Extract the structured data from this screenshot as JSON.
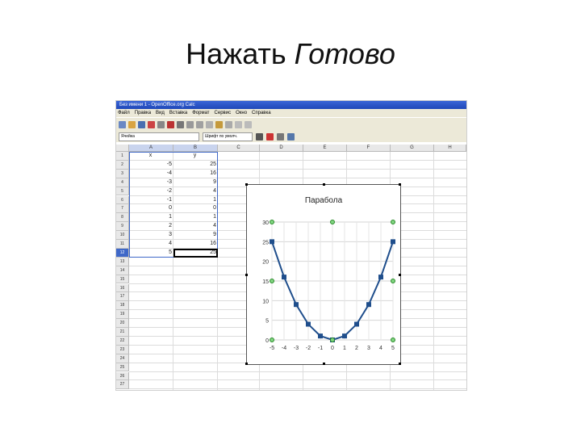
{
  "slide": {
    "title_normal": "Нажать ",
    "title_italic": "Готово"
  },
  "window": {
    "title": "Без имени 1 - OpenOffice.org Calc"
  },
  "menu": [
    "Файл",
    "Правка",
    "Вид",
    "Вставка",
    "Формат",
    "Сервис",
    "Окно",
    "Справка"
  ],
  "formula_bar": {
    "name_box": "Ячейка",
    "font_box": "Шрифт по умолч."
  },
  "columns": [
    "A",
    "B",
    "C",
    "D",
    "E",
    "F",
    "G",
    "H"
  ],
  "rows": [
    "1",
    "2",
    "3",
    "4",
    "5",
    "6",
    "7",
    "8",
    "9",
    "10",
    "11",
    "12",
    "13",
    "14",
    "15",
    "16",
    "17",
    "18",
    "19",
    "20",
    "21",
    "22",
    "23",
    "24",
    "25",
    "26",
    "27"
  ],
  "selected_row": "12",
  "table": {
    "header": [
      "x",
      "y"
    ],
    "x_values": [
      "-5",
      "-4",
      "-3",
      "-2",
      "-1",
      "0",
      "1",
      "2",
      "3",
      "4",
      "5"
    ],
    "y_values": [
      "25",
      "16",
      "9",
      "4",
      "1",
      "0",
      "1",
      "4",
      "9",
      "16",
      "25"
    ]
  },
  "chart_data": {
    "type": "line",
    "title": "Парабола",
    "x": [
      -5,
      -4,
      -3,
      -2,
      -1,
      0,
      1,
      2,
      3,
      4,
      5
    ],
    "series": [
      {
        "values": [
          25,
          16,
          9,
          4,
          1,
          0,
          1,
          4,
          9,
          16,
          25
        ],
        "color": "#1f4e8c"
      }
    ],
    "x_ticks": [
      "-5",
      "-4",
      "-3",
      "-2",
      "-1",
      "0",
      "1",
      "2",
      "3",
      "4",
      "5"
    ],
    "y_ticks": [
      "0",
      "5",
      "10",
      "15",
      "20",
      "25",
      "30"
    ],
    "ylim": [
      0,
      30
    ],
    "grid": true,
    "legend": "none"
  }
}
